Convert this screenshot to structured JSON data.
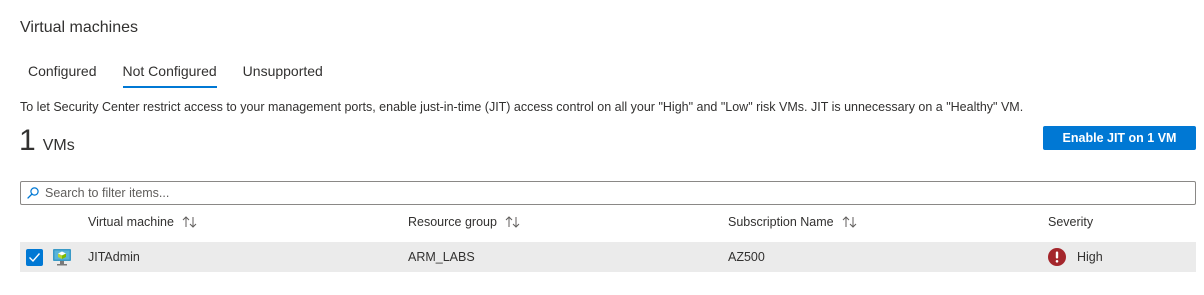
{
  "page": {
    "title": "Virtual machines",
    "tabs": [
      {
        "label": "Configured"
      },
      {
        "label": "Not Configured"
      },
      {
        "label": "Unsupported"
      }
    ],
    "active_tab": "Not Configured",
    "description": "To let Security Center restrict access to your management ports, enable just-in-time (JIT) access control on all your \"High\" and \"Low\" risk VMs. JIT is unnecessary on a \"Healthy\" VM.",
    "vm_count": "1",
    "vm_count_unit": "VMs",
    "enable_button": "Enable JIT on 1 VM"
  },
  "search": {
    "placeholder": "Search to filter items...",
    "icon": "search-icon"
  },
  "table": {
    "headers": [
      {
        "label": "Virtual machine",
        "sortable": true
      },
      {
        "label": "Resource group",
        "sortable": true
      },
      {
        "label": "Subscription Name",
        "sortable": true
      },
      {
        "label": "Severity",
        "sortable": false
      }
    ],
    "rows": [
      {
        "selected": true,
        "vm_icon": "virtual-machine-icon",
        "virtual_machine": "JITAdmin",
        "resource_group": "ARM_LABS",
        "subscription": "AZ500",
        "severity": "High",
        "severity_icon": "error-icon"
      }
    ]
  },
  "colors": {
    "accent": "#0078d4",
    "severity_high": "#a4262c",
    "selected_row": "#ebebeb"
  }
}
